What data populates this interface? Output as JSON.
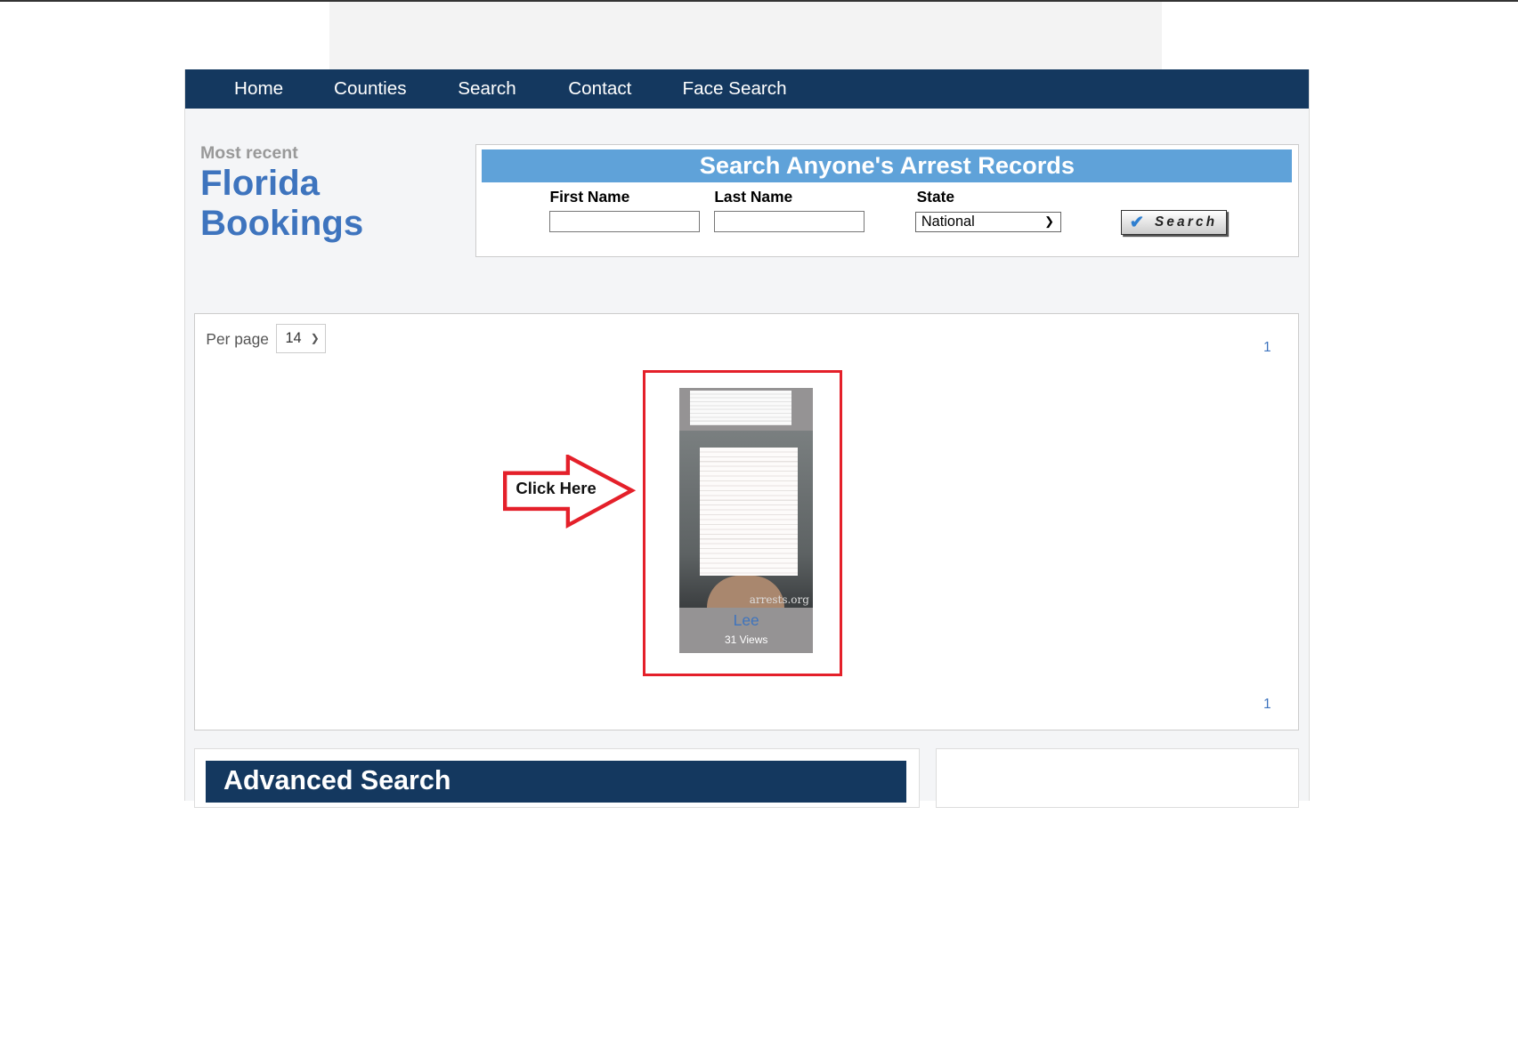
{
  "nav": {
    "items": [
      "Home",
      "Counties",
      "Search",
      "Contact",
      "Face Search"
    ]
  },
  "heading": {
    "kicker": "Most recent",
    "title_line1": "Florida",
    "title_line2": "Bookings"
  },
  "search_form": {
    "title": "Search Anyone's Arrest Records",
    "first_name_label": "First Name",
    "first_name_value": "",
    "last_name_label": "Last Name",
    "last_name_value": "",
    "state_label": "State",
    "state_selected": "National",
    "search_button": "Search"
  },
  "listing": {
    "per_page_label": "Per page",
    "per_page_value": "14",
    "page_top": "1",
    "page_bottom": "1",
    "annotation": "Click Here",
    "annotation_color": "#e4202a",
    "cards": [
      {
        "county": "Lee",
        "views": "31 Views",
        "watermark": "arrests.org"
      }
    ]
  },
  "advanced_search": {
    "title": "Advanced Search"
  },
  "colors": {
    "nav": "#14385f",
    "header": "#5fa2d9",
    "link": "#3e74be"
  }
}
